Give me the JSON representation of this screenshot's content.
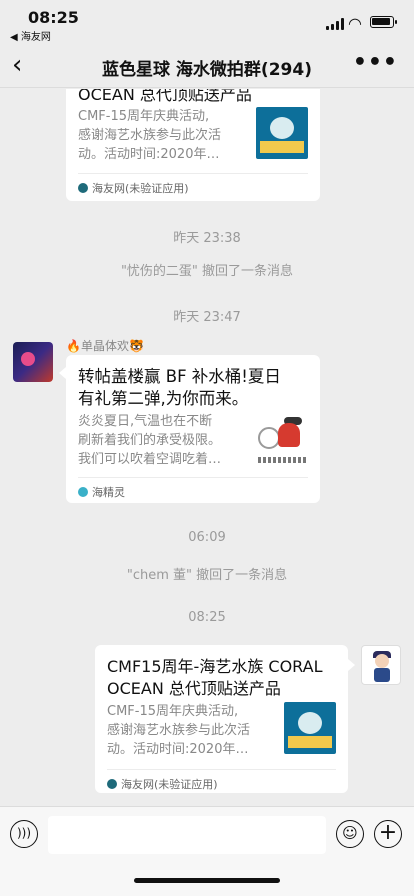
{
  "status_bar": {
    "time": "08:25",
    "back_app": "◀ 海友网",
    "icons": [
      "signal-icon",
      "wifi-icon",
      "battery-icon"
    ]
  },
  "nav": {
    "back_icon": "‹",
    "title": "蓝色星球 海水微拍群(294)",
    "mute_icon": "🔕",
    "more_icon": "•••"
  },
  "messages": {
    "card_top": {
      "title_tail": "OCEAN 总代顶贴送产品",
      "desc_line1": "CMF-15周年庆典活动,",
      "desc_line2": "感谢海艺水族参与此次活",
      "desc_line3": "动。活动时间:2020年…",
      "source": "海友网(未验证应用)"
    },
    "time1": "昨天 23:38",
    "recall1": "\"忧伤的二蛋\" 撤回了一条消息",
    "time2": "昨天 23:47",
    "sender_name": "🔥单晶体欢🐯",
    "card_mid": {
      "title_line1": "转帖盖楼赢 BF 补水桶!夏日",
      "title_line2": "有礼第二弹,为你而来。",
      "desc_line1": "炎炎夏日,气温也在不断",
      "desc_line2": "刷新着我们的承受极限。",
      "desc_line3": "我们可以吹着空调吃着…",
      "source": "海精灵"
    },
    "time3": "06:09",
    "recall2": "\"chem 董\" 撤回了一条消息",
    "time4": "08:25",
    "card_bottom": {
      "title_line1": "CMF15周年-海艺水族 CORAL",
      "title_line2": "OCEAN 总代顶贴送产品",
      "desc_line1": "CMF-15周年庆典活动,",
      "desc_line2": "感谢海艺水族参与此次活",
      "desc_line3": "动。活动时间:2020年…",
      "source": "海友网(未验证应用)"
    }
  },
  "input_bar": {
    "voice_icon": "🔊",
    "emoji_icon": "☺",
    "plus_icon": "+"
  }
}
